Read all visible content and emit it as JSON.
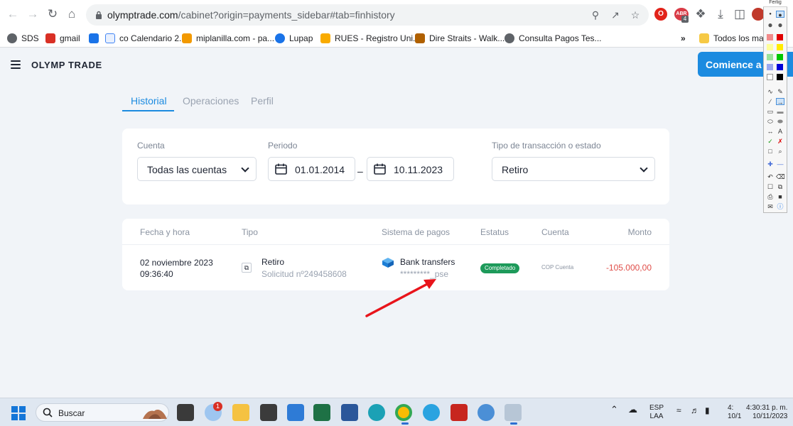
{
  "browser": {
    "url_host": "olymptrade.com",
    "url_path": "/cabinet?origin=payments_sidebar#tab=finhistory",
    "extension_badge_label": "ABR",
    "extension_badge_count": "4",
    "bookmarks": [
      {
        "label": "SDS",
        "icon": "globe-icon",
        "color": "#5f6368"
      },
      {
        "label": "gmail",
        "icon": "gmail-icon",
        "color": "#d93025"
      },
      {
        "label": "",
        "icon": "calendar-icon",
        "color": "#1a73e8"
      },
      {
        "label": "co Calendario 2...",
        "icon": "page-icon",
        "color": "#4285f4"
      },
      {
        "label": "miplanilla.com - pa...",
        "icon": "check-icon",
        "color": "#f29900"
      },
      {
        "label": "Lupap",
        "icon": "lupap-icon",
        "color": "#1a73e8"
      },
      {
        "label": "RUES - Registro Uni...",
        "icon": "rues-icon",
        "color": "#f9ab00"
      },
      {
        "label": "Dire Straits - Walk...",
        "icon": "music-icon",
        "color": "#b06000"
      },
      {
        "label": "Consulta Pagos Tes...",
        "icon": "globe-icon",
        "color": "#5f6368"
      }
    ],
    "bookmarks_overflow": "»",
    "bookmarks_folder": "Todos los marca"
  },
  "site": {
    "brand": "OLYMP TRADE",
    "cta_label": "Comience a O"
  },
  "tabs": [
    {
      "label": "Historial",
      "active": true
    },
    {
      "label": "Operaciones",
      "active": false
    },
    {
      "label": "Perfil",
      "active": false
    }
  ],
  "filters": {
    "account_label": "Cuenta",
    "account_value": "Todas las cuentas",
    "period_label": "Periodo",
    "date_from": "01.01.2014",
    "date_separator": "–",
    "date_to": "10.11.2023",
    "type_label": "Tipo de transacción o estado",
    "type_value": "Retiro"
  },
  "table": {
    "headers": {
      "datetime": "Fecha y hora",
      "type": "Tipo",
      "payment": "Sistema de pagos",
      "status": "Estatus",
      "account": "Cuenta",
      "amount": "Monto"
    },
    "rows": [
      {
        "date": "02 noviembre 2023",
        "time": "09:36:40",
        "type": "Retiro",
        "request": "Solicitud nº249458608",
        "payment_system": "Bank transfers",
        "payment_detail": "*********_pse",
        "status": "Completado",
        "account": "COP Cuenta",
        "amount": "-105.000,00"
      }
    ]
  },
  "colors": {
    "accent": "#1c8be0",
    "status_completed": "#1d9a5a",
    "amount_negative": "#e04e49",
    "annotation_arrow": "#e8141b"
  },
  "palette": {
    "title": "Ferlig"
  },
  "taskbar": {
    "search_label": "Buscar",
    "notification_badge": "1",
    "language": "ESP",
    "keyboard": "LAA",
    "time_partial": "4:",
    "time": "4:30:31 p. m.",
    "date_partial": "10/1",
    "date": "10/11/2023"
  }
}
